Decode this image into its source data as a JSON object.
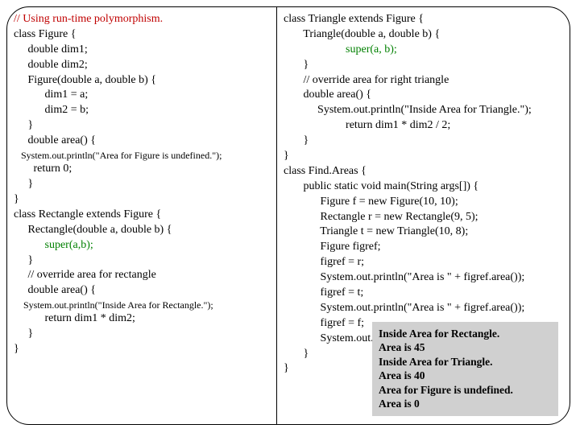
{
  "left": {
    "l1": "// Using run-time polymorphism.",
    "l2": "class Figure {",
    "l3": "     double dim1;",
    "l4": "     double dim2;",
    "l5": "     Figure(double a, double b) {",
    "l6": "           dim1 = a;",
    "l7": "           dim2 = b;",
    "l8": "     }",
    "l9": "     double area() {",
    "l10": "   System.out.println(\"Area for Figure is undefined.\");",
    "l11": "       return 0;",
    "l12": "     }",
    "l13": "}",
    "l14": "class Rectangle extends Figure {",
    "l15": "     Rectangle(double a, double b) {",
    "l16": "           super(a,b);",
    "l17": "     }",
    "l18": "     // override area for rectangle",
    "l19": "     double area() {",
    "l20": "    System.out.println(\"Inside Area for Rectangle.\");",
    "l21": "           return dim1 * dim2;",
    "l22": "     }",
    "l23": "}"
  },
  "right": {
    "r1": "class Triangle extends Figure {",
    "r2": "       Triangle(double a, double b) {",
    "r3": "                      super(a, b);",
    "r4": "       }",
    "r5": "       // override area for right triangle",
    "r6": "       double area() {",
    "r7": "            System.out.println(\"Inside Area for Triangle.\");",
    "r8": "                      return dim1 * dim2 / 2;",
    "r9": "       }",
    "r10": "}",
    "r11": "",
    "r12": "class Find.Areas {",
    "r13": "       public static void main(String args[]) {",
    "r14": "             Figure f = new Figure(10, 10);",
    "r15": "             Rectangle r = new Rectangle(9, 5);",
    "r16": "             Triangle t = new Triangle(10, 8);",
    "r17": "             Figure figref;",
    "r18": "             figref = r;",
    "r19": "             System.out.println(\"Area is \" + figref.area());",
    "r20": "             figref = t;",
    "r21": "             System.out.println(\"Area is \" + figref.area());",
    "r22": "             figref = f;",
    "r23": "             System.out.println(\"Area is \" + figref.area());",
    "r24": "       }",
    "r25": "}"
  },
  "output": {
    "o1": "Inside Area for Rectangle.",
    "o2": "Area is 45",
    "o3": "Inside Area for Triangle.",
    "o4": "Area is 40",
    "o5": "Area for Figure is undefined.",
    "o6": "Area is 0"
  }
}
